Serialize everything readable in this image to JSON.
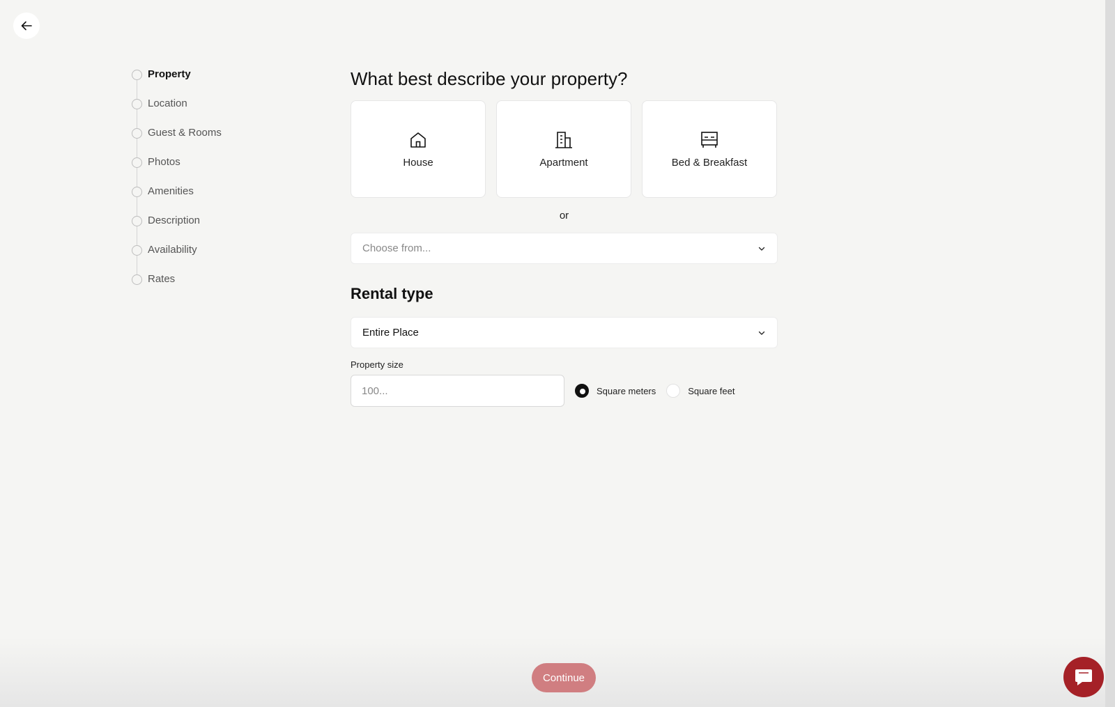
{
  "nav": {
    "back_icon": "arrow-left-icon"
  },
  "stepper": {
    "steps": [
      {
        "label": "Property",
        "active": true
      },
      {
        "label": "Location",
        "active": false
      },
      {
        "label": "Guest & Rooms",
        "active": false
      },
      {
        "label": "Photos",
        "active": false
      },
      {
        "label": "Amenities",
        "active": false
      },
      {
        "label": "Description",
        "active": false
      },
      {
        "label": "Availability",
        "active": false
      },
      {
        "label": "Rates",
        "active": false
      }
    ]
  },
  "property": {
    "heading": "What best describe your property?",
    "cards": [
      {
        "label": "House",
        "icon": "house-icon"
      },
      {
        "label": "Apartment",
        "icon": "apartment-building-icon"
      },
      {
        "label": "Bed & Breakfast",
        "icon": "bed-icon"
      }
    ],
    "or_text": "or",
    "choose_placeholder": "Choose from..."
  },
  "rental": {
    "heading": "Rental type",
    "selected": "Entire Place"
  },
  "size": {
    "label": "Property size",
    "placeholder": "100...",
    "units": [
      {
        "label": "Square meters",
        "checked": true
      },
      {
        "label": "Square feet",
        "checked": false
      }
    ]
  },
  "footer": {
    "continue_label": "Continue",
    "continue_color": "#d07e81",
    "chat_icon": "chat-bubble-icon",
    "chat_color": "#a52127"
  }
}
